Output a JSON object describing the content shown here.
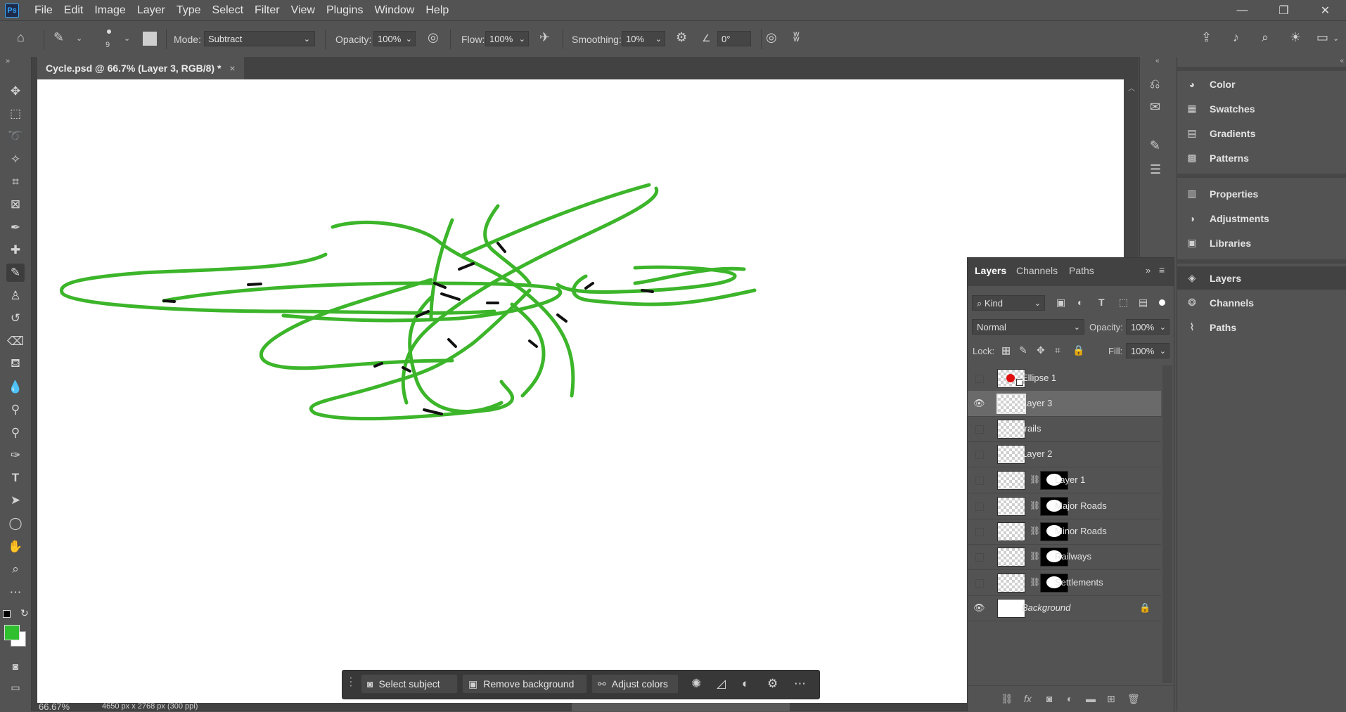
{
  "app": {
    "logo": "Ps"
  },
  "menu": [
    "File",
    "Edit",
    "Image",
    "Layer",
    "Type",
    "Select",
    "Filter",
    "View",
    "Plugins",
    "Window",
    "Help"
  ],
  "window_controls": {
    "minimize": "—",
    "restore": "❐",
    "close": "✕"
  },
  "options": {
    "brush_size": "9",
    "mode_label": "Mode:",
    "mode_value": "Subtract",
    "opacity_label": "Opacity:",
    "opacity_value": "100%",
    "flow_label": "Flow:",
    "flow_value": "100%",
    "smoothing_label": "Smoothing:",
    "smoothing_value": "10%",
    "angle_value": "0°"
  },
  "document": {
    "tab_title": "Cycle.psd @ 66.7% (Layer 3, RGB/8) *",
    "close": "×"
  },
  "colors": {
    "foreground": "#2fbf2f",
    "background": "#ffffff",
    "stroke": "#3cb52a",
    "accent": "#31a8ff"
  },
  "status": {
    "zoom": "66.67%",
    "doc_size": "4650 px x 2768 px (300 ppi)"
  },
  "taskbar": {
    "select_subject": "Select subject",
    "remove_background": "Remove background",
    "adjust_colors": "Adjust colors",
    "more": "⋯"
  },
  "right_panels": {
    "group1": [
      "Color",
      "Swatches",
      "Gradients",
      "Patterns"
    ],
    "group2": [
      "Properties",
      "Adjustments",
      "Libraries"
    ],
    "group3": [
      "Layers",
      "Channels",
      "Paths"
    ]
  },
  "layers_panel": {
    "tabs": [
      "Layers",
      "Channels",
      "Paths"
    ],
    "filter_kind": "Kind",
    "blend_mode": "Normal",
    "opacity_label": "Opacity:",
    "opacity_value": "100%",
    "lock_label": "Lock:",
    "fill_label": "Fill:",
    "fill_value": "100%",
    "layers": [
      {
        "name": "Ellipse 1",
        "visible": false,
        "selected": false,
        "mask": false
      },
      {
        "name": "Layer 3",
        "visible": true,
        "selected": true,
        "mask": false
      },
      {
        "name": "trails",
        "visible": false,
        "selected": false,
        "mask": false
      },
      {
        "name": "Layer 2",
        "visible": false,
        "selected": false,
        "mask": false
      },
      {
        "name": "Layer 1",
        "visible": false,
        "selected": false,
        "mask": true
      },
      {
        "name": "Major Roads",
        "visible": false,
        "selected": false,
        "mask": true
      },
      {
        "name": "Minor Roads",
        "visible": false,
        "selected": false,
        "mask": true
      },
      {
        "name": "Railways",
        "visible": false,
        "selected": false,
        "mask": true
      },
      {
        "name": "Settlements",
        "visible": false,
        "selected": false,
        "mask": true
      },
      {
        "name": "Background",
        "visible": true,
        "selected": false,
        "mask": false,
        "locked": true
      }
    ]
  }
}
